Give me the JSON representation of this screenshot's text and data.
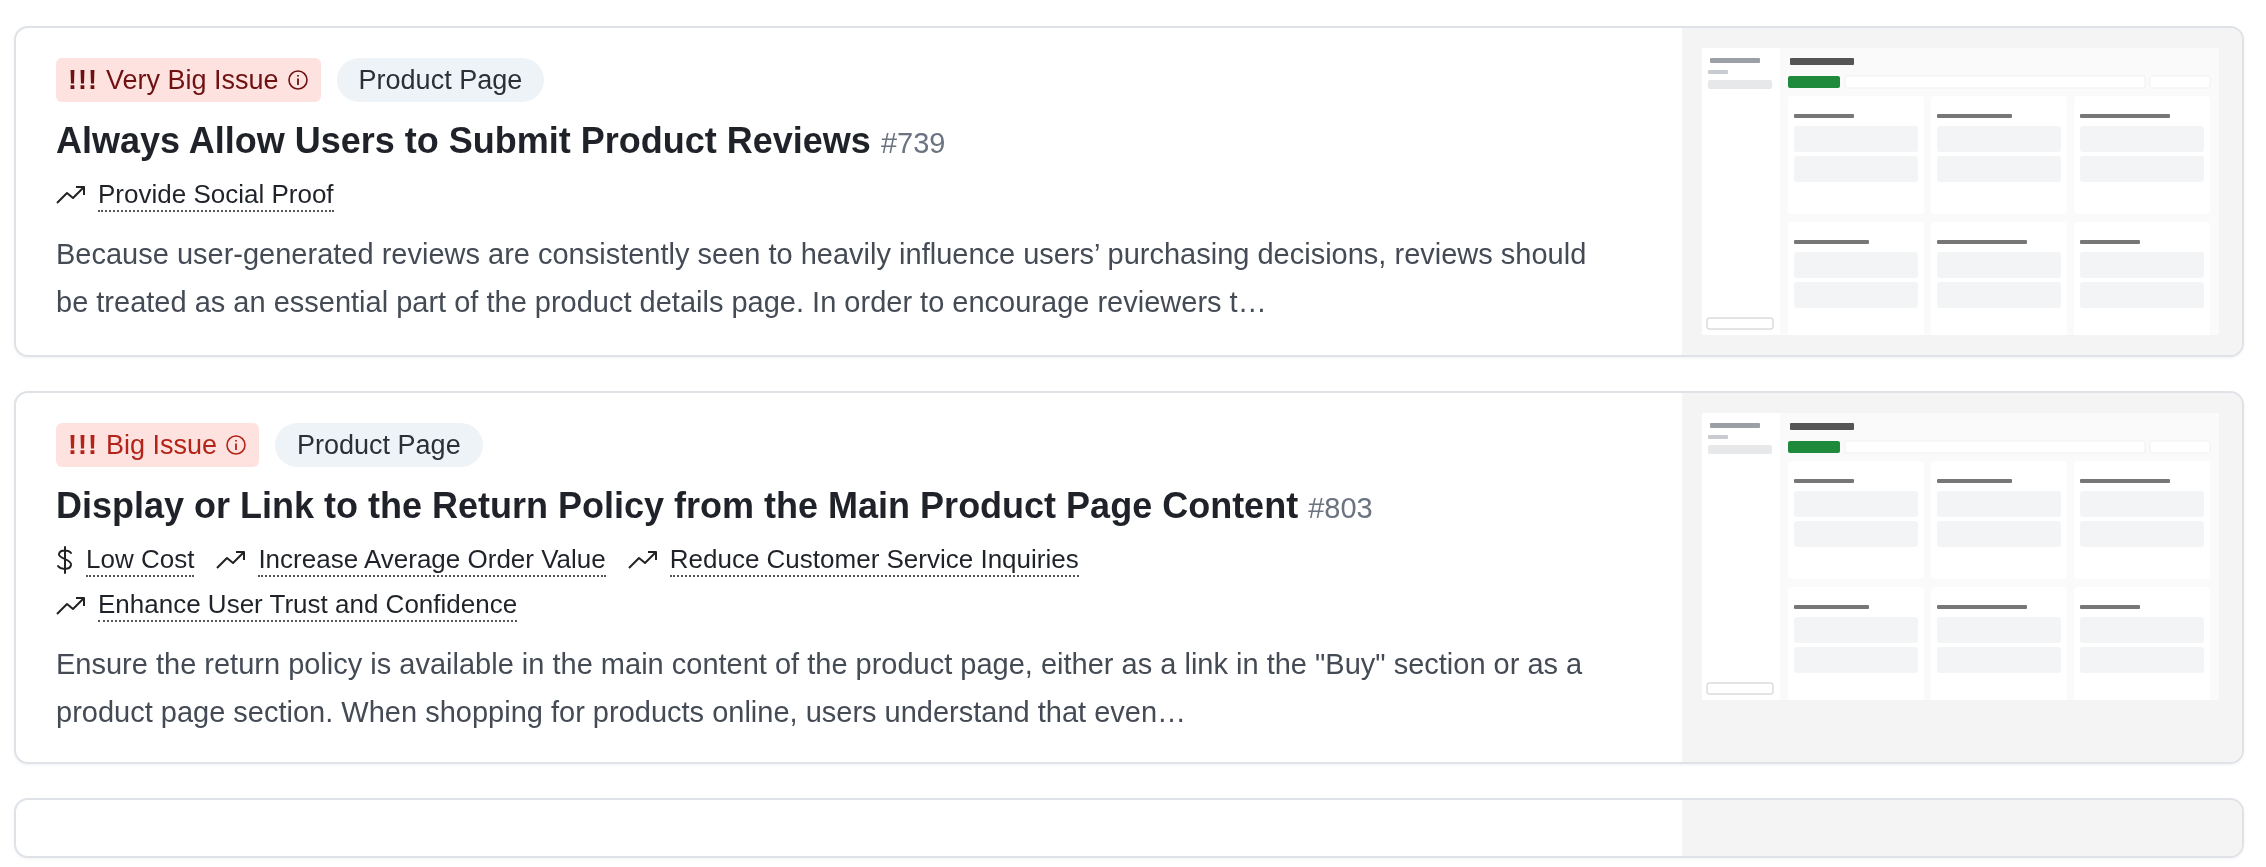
{
  "cards": [
    {
      "severity": {
        "kind": "very-big",
        "marker": "!!!",
        "label": "Very Big Issue"
      },
      "category": "Product Page",
      "title": "Always Allow Users to Submit Product Reviews",
      "number": "#739",
      "tags": [
        {
          "kind": "trend",
          "label": "Provide Social Proof"
        }
      ],
      "description": "Because user-generated reviews are consistently seen to heavily influence users’ purchasing decisions, reviews should be treated as an essential part of the product details page. In order to encourage reviewers t…"
    },
    {
      "severity": {
        "kind": "big",
        "marker": "!!!",
        "label": "Big Issue"
      },
      "category": "Product Page",
      "title": "Display or Link to the Return Policy from the Main Product Page Content",
      "number": "#803",
      "tags": [
        {
          "kind": "cost",
          "label": "Low Cost"
        },
        {
          "kind": "trend",
          "label": "Increase Average Order Value"
        },
        {
          "kind": "trend",
          "label": "Reduce Customer Service Inquiries"
        },
        {
          "kind": "trend",
          "label": "Enhance User Trust and Confidence"
        }
      ],
      "description": "Ensure the return policy is available in the main content of the product page, either as a link in the \"Buy\" section or as a product page section. When shopping for products online, users understand that even…"
    }
  ]
}
